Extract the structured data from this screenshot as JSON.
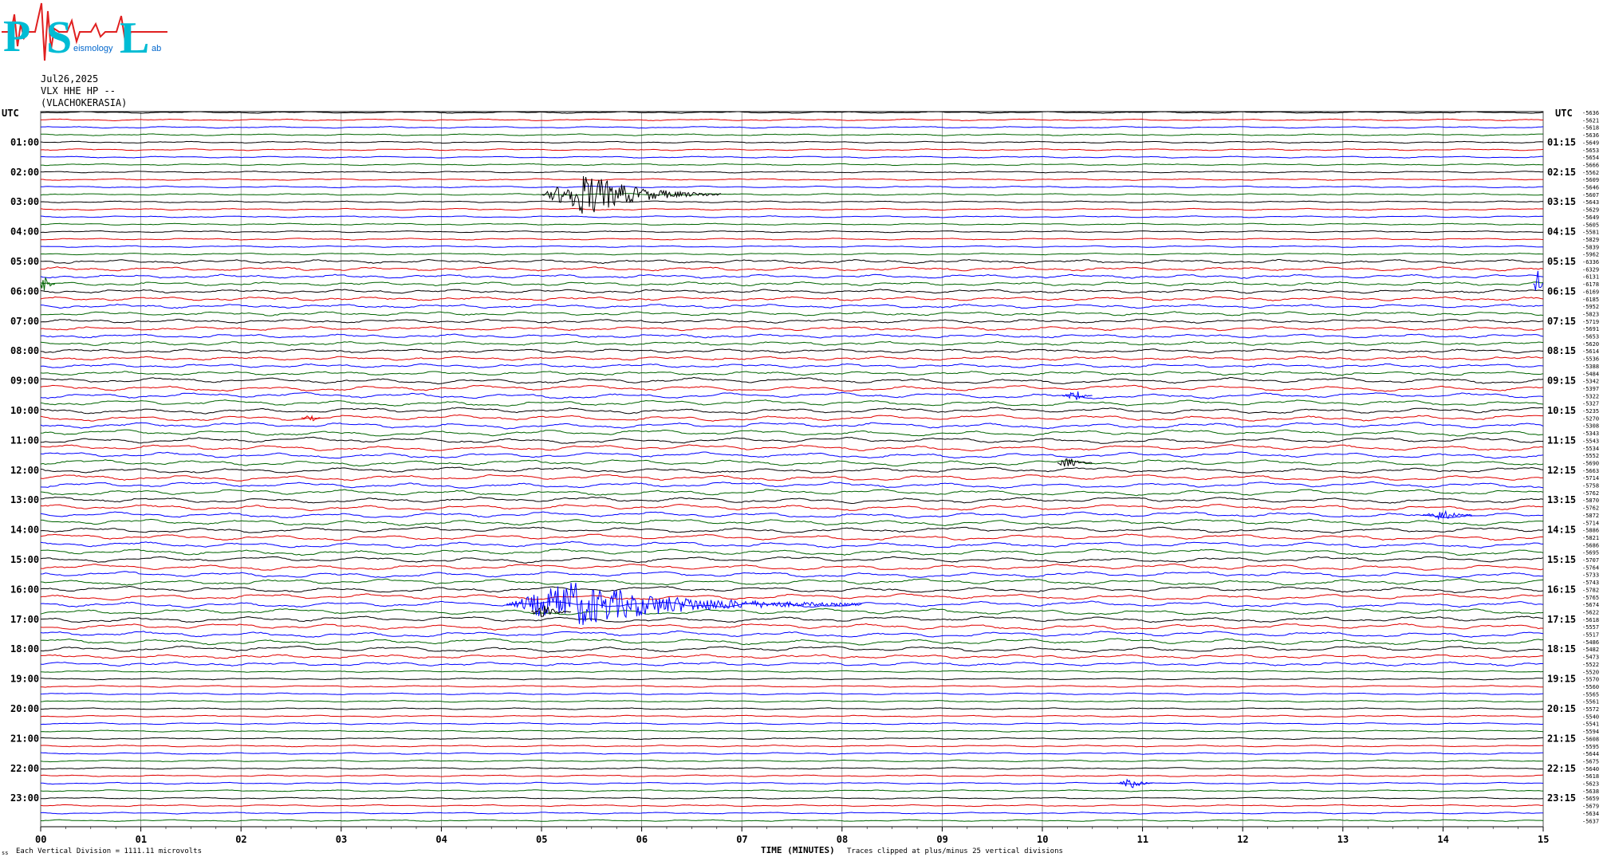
{
  "logo": {
    "letters": [
      "P",
      "S",
      "L"
    ],
    "small_text_1": "eismology",
    "small_text_2": "ab",
    "colors": {
      "letters": "#00bcd4",
      "seismogram": "#e02020"
    }
  },
  "header": {
    "date": "Jul26,2025",
    "station": "VLX HHE HP --",
    "location": "(VLACHOKERASIA)"
  },
  "chart_data": {
    "type": "line",
    "title": "",
    "left_axis_label": "UTC",
    "right_axis_label": "UTC",
    "left_time_labels": [
      "01:00",
      "02:00",
      "03:00",
      "04:00",
      "05:00",
      "06:00",
      "07:00",
      "08:00",
      "09:00",
      "10:00",
      "11:00",
      "12:00",
      "13:00",
      "14:00",
      "15:00",
      "16:00",
      "17:00",
      "18:00",
      "19:00",
      "20:00",
      "21:00",
      "22:00",
      "23:00"
    ],
    "right_time_labels": [
      "01:15",
      "02:15",
      "03:15",
      "04:15",
      "05:15",
      "06:15",
      "07:15",
      "08:15",
      "09:15",
      "10:15",
      "11:15",
      "12:15",
      "13:15",
      "14:15",
      "15:15",
      "16:15",
      "17:15",
      "18:15",
      "19:15",
      "20:15",
      "21:15",
      "22:15",
      "23:15"
    ],
    "xlabel": "TIME (MINUTES)",
    "x_tick_labels": [
      "00",
      "01",
      "02",
      "03",
      "04",
      "05",
      "06",
      "07",
      "08",
      "09",
      "10",
      "11",
      "12",
      "13",
      "14",
      "15"
    ],
    "xlim": [
      0,
      15
    ],
    "trace_minutes": 15,
    "trace_count": 96,
    "trace_colors": [
      "#000000",
      "#e00000",
      "#0000ff",
      "#006400"
    ],
    "trace_offsets": [
      "-5636",
      "-5621",
      "-5618",
      "-5636",
      "-5649",
      "-5653",
      "-5654",
      "-5666",
      "-5562",
      "-5609",
      "-5646",
      "-5607",
      "-5643",
      "-5629",
      "-5649",
      "-5605",
      "-5581",
      "-5829",
      "-5839",
      "-5962",
      "-6336",
      "-6329",
      "-6131",
      "-6178",
      "-6169",
      "-6185",
      "-5952",
      "-5823",
      "-5719",
      "-5691",
      "-5653",
      "-5620",
      "-5614",
      "-5536",
      "-5388",
      "-5484",
      "-5342",
      "-5397",
      "-5322",
      "-5327",
      "-5235",
      "-5270",
      "-5308",
      "-5343",
      "-5543",
      "-5534",
      "-5552",
      "-5690",
      "-5663",
      "-5714",
      "-5758",
      "-5762",
      "-5870",
      "-5762",
      "-5872",
      "-5714",
      "-5886",
      "-5821",
      "-5686",
      "-5695",
      "-5707",
      "-5764",
      "-5733",
      "-5743",
      "-5782",
      "-5765",
      "-5674",
      "-5622",
      "-5618",
      "-5557",
      "-5517",
      "-5486",
      "-5482",
      "-5473",
      "-5522",
      "-5520",
      "-5570",
      "-5560",
      "-5565",
      "-5561",
      "-5572",
      "-5540",
      "-5541",
      "-5594",
      "-5608",
      "-5595",
      "-5644",
      "-5675",
      "-5640",
      "-5618",
      "-5623",
      "-5638",
      "-5659",
      "-5679",
      "-5634",
      "-5637"
    ],
    "events": [
      {
        "trace": 11,
        "start_min": 5.0,
        "end_min": 6.8,
        "peak_min": 5.45,
        "amplitude": 3.0,
        "color": "#000000"
      },
      {
        "trace": 66,
        "start_min": 4.65,
        "end_min": 8.2,
        "peak_min": 5.3,
        "amplitude": 3.2,
        "color": "#0000ff"
      },
      {
        "trace": 67,
        "start_min": 4.9,
        "end_min": 5.3,
        "peak_min": 5.0,
        "amplitude": 1.2,
        "color": "#000000"
      },
      {
        "trace": 23,
        "start_min": 14.9,
        "end_min": 15.0,
        "peak_min": 14.97,
        "amplitude": 3.0,
        "color": "#0000ff"
      },
      {
        "trace": 23,
        "start_min": 0.0,
        "end_min": 0.15,
        "peak_min": 0.03,
        "amplitude": 1.5,
        "color": "#006400"
      },
      {
        "trace": 47,
        "start_min": 10.15,
        "end_min": 10.5,
        "peak_min": 10.25,
        "amplitude": 0.9,
        "color": "#000000"
      },
      {
        "trace": 41,
        "start_min": 2.6,
        "end_min": 2.8,
        "peak_min": 2.7,
        "amplitude": 0.7,
        "color": "#e00000"
      },
      {
        "trace": 38,
        "start_min": 10.2,
        "end_min": 10.5,
        "peak_min": 10.35,
        "amplitude": 0.7,
        "color": "#0000ff"
      },
      {
        "trace": 54,
        "start_min": 13.8,
        "end_min": 14.3,
        "peak_min": 14.0,
        "amplitude": 0.8,
        "color": "#0000ff"
      },
      {
        "trace": 90,
        "start_min": 10.75,
        "end_min": 11.1,
        "peak_min": 10.9,
        "amplitude": 0.8,
        "color": "#0000ff"
      }
    ],
    "grid": "vertical"
  },
  "footer": {
    "division_note": "Each Vertical Division = 1111.11 microvolts",
    "clip_note": "Traces clipped at plus/minus 25 vertical divisions",
    "corner_mark": "ss"
  }
}
